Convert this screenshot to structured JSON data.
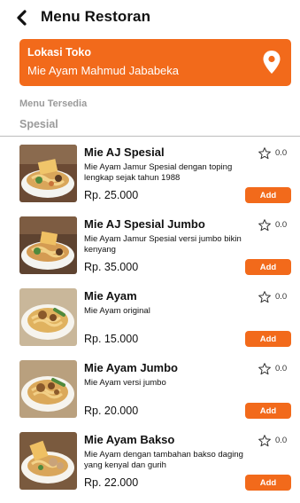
{
  "header": {
    "title": "Menu Restoran"
  },
  "location": {
    "label": "Lokasi Toko",
    "value": "Mie Ayam Mahmud Jababeka"
  },
  "menu_label": "Menu Tersedia",
  "section_title": "Spesial",
  "colors": {
    "accent": "#f26a1b"
  },
  "items": [
    {
      "name": "Mie AJ Spesial",
      "desc": "Mie Ayam Jamur Spesial dengan toping lengkap sejak tahun 1988",
      "price": "Rp. 25.000",
      "rating": "0.0",
      "add_label": "Add"
    },
    {
      "name": "Mie AJ Spesial Jumbo",
      "desc": "Mie Ayam Jamur Spesial versi jumbo bikin kenyang",
      "price": "Rp. 35.000",
      "rating": "0.0",
      "add_label": "Add"
    },
    {
      "name": "Mie Ayam",
      "desc": "Mie Ayam original",
      "price": "Rp. 15.000",
      "rating": "0.0",
      "add_label": "Add"
    },
    {
      "name": "Mie Ayam Jumbo",
      "desc": "Mie Ayam versi jumbo",
      "price": "Rp. 20.000",
      "rating": "0.0",
      "add_label": "Add"
    },
    {
      "name": "Mie Ayam Bakso",
      "desc": "Mie Ayam dengan tambahan bakso daging yang kenyal dan gurih",
      "price": "Rp. 22.000",
      "rating": "0.0",
      "add_label": "Add"
    }
  ]
}
